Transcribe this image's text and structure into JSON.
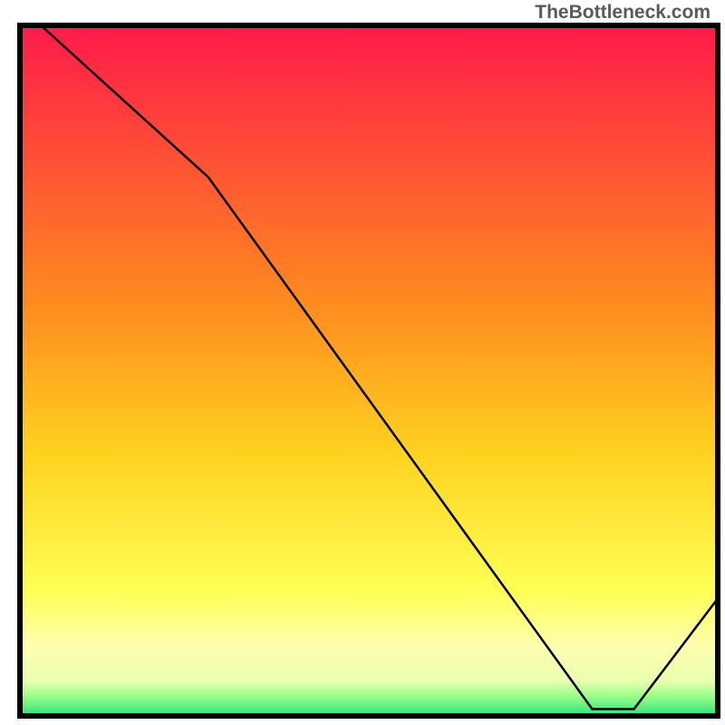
{
  "watermark": "TheBottleneck.com",
  "chart_data": {
    "type": "line",
    "title": "",
    "xlabel": "",
    "ylabel": "",
    "xlim": [
      0,
      100
    ],
    "ylim": [
      0,
      100
    ],
    "x": [
      3,
      27,
      82,
      88,
      100
    ],
    "values": [
      100,
      78,
      1,
      1,
      17
    ],
    "annotation_text": "",
    "annotation_pos": {
      "x": 82,
      "y": 2
    },
    "gradient_stops": [
      {
        "offset": 0,
        "color": "#ff1a4a"
      },
      {
        "offset": 40,
        "color": "#ff8a1f"
      },
      {
        "offset": 62,
        "color": "#ffd21f"
      },
      {
        "offset": 82,
        "color": "#ffff55"
      },
      {
        "offset": 90,
        "color": "#ffffb0"
      },
      {
        "offset": 95,
        "color": "#e8ffb0"
      },
      {
        "offset": 97,
        "color": "#9fff8a"
      },
      {
        "offset": 100,
        "color": "#2ee07a"
      }
    ],
    "frame": true
  }
}
